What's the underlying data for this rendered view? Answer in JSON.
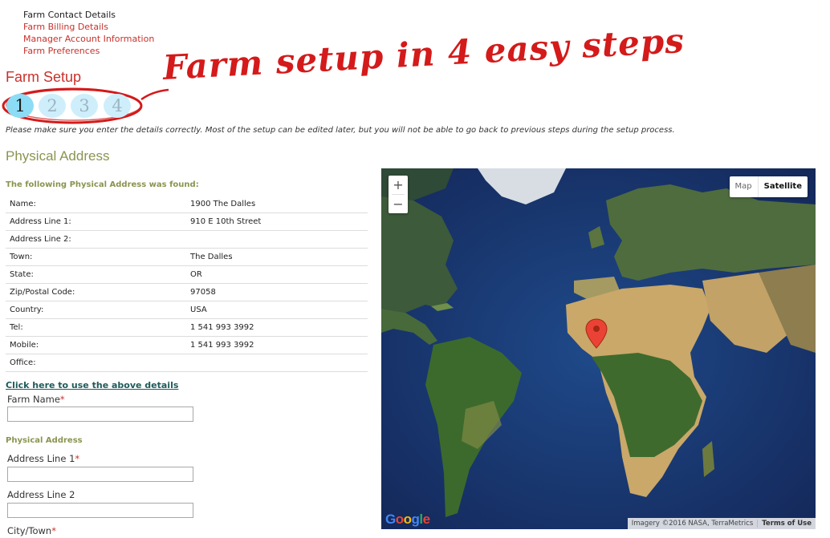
{
  "steps_nav": {
    "current": "Farm Contact Details",
    "items": [
      "Farm Billing Details",
      "Manager Account Information",
      "Farm Preferences"
    ]
  },
  "page_title": "Farm Setup",
  "annotation": "Farm setup in 4 easy steps",
  "step_numbers": [
    "1",
    "2",
    "3",
    "4"
  ],
  "notice": "Please make sure you enter the details correctly. Most of the setup can be edited later, but you will not be able to go back to previous steps during the setup process.",
  "section_title": "Physical Address",
  "found_heading": "The following Physical Address was found:",
  "address_rows": [
    {
      "label": "Name:",
      "value": "1900 The Dalles"
    },
    {
      "label": "Address Line 1:",
      "value": "910 E 10th Street"
    },
    {
      "label": "Address Line 2:",
      "value": ""
    },
    {
      "label": "Town:",
      "value": "The Dalles"
    },
    {
      "label": "State:",
      "value": "OR"
    },
    {
      "label": "Zip/Postal Code:",
      "value": "97058"
    },
    {
      "label": "Country:",
      "value": "USA"
    },
    {
      "label": "Tel:",
      "value": "1 541 993 3992"
    },
    {
      "label": "Mobile:",
      "value": "1 541 993 3992"
    },
    {
      "label": "Office:",
      "value": ""
    }
  ],
  "use_details_link": "Click here to use the above details",
  "form": {
    "farm_name_label": "Farm Name",
    "physical_address_heading": "Physical Address",
    "address1_label": "Address Line 1",
    "address2_label": "Address Line 2",
    "city_label": "City/Town",
    "required_mark": "*"
  },
  "map": {
    "zoom_in": "+",
    "zoom_out": "−",
    "type_map": "Map",
    "type_satellite": "Satellite",
    "google_logo": "Google",
    "imagery": "Imagery ©2016 NASA, TerraMetrics",
    "terms": "Terms of Use",
    "selected_type": "Satellite"
  },
  "colors": {
    "accent_red": "#c8312c",
    "olive": "#8b9450",
    "step_active": "#8ddcf5",
    "step_inactive": "#cfeefb"
  }
}
